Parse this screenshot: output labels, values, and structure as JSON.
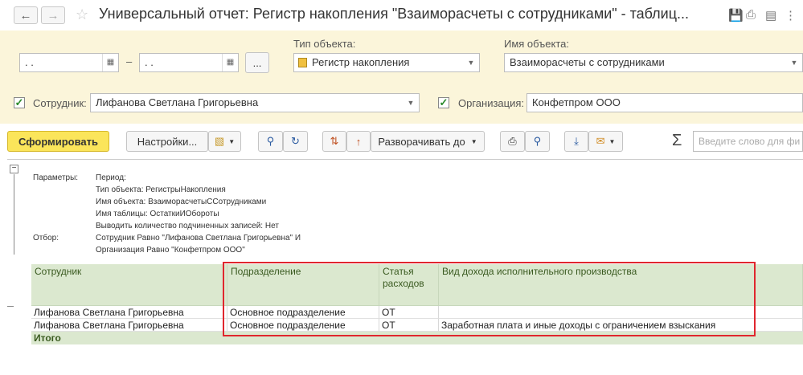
{
  "window": {
    "title": "Универсальный отчет: Регистр накопления \"Взаиморасчеты с сотрудниками\" - таблиц..."
  },
  "form": {
    "date_from": " .  . ",
    "date_sep": "–",
    "date_to": " .  . ",
    "more_btn": "...",
    "object_type_label": "Тип объекта:",
    "object_type_value": "Регистр накопления",
    "object_name_label": "Имя объекта:",
    "object_name_value": "Взаиморасчеты с сотрудниками",
    "employee_label": "Сотрудник:",
    "employee_value": "Лифанова Светлана Григорьевна",
    "org_label": "Организация:",
    "org_value": "Конфетпром ООО"
  },
  "toolbar": {
    "generate": "Сформировать",
    "settings": "Настройки...",
    "expand": "Разворачивать до",
    "search_placeholder": "Введите слово для фи"
  },
  "report": {
    "params_label": "Параметры:",
    "params": [
      "Период:",
      "Тип объекта: РегистрыНакопления",
      "Имя объекта: ВзаиморасчетыССотрудниками",
      "Имя таблицы: ОстаткиИОбороты",
      "Выводить количество подчиненных записей: Нет"
    ],
    "filter_label": "Отбор:",
    "filters": [
      "Сотрудник Равно \"Лифанова Светлана Григорьевна\" И",
      "Организация Равно \"Конфетпром ООО\""
    ],
    "columns": {
      "employee": "Сотрудник",
      "division": "Подразделение",
      "expense": "Статья расходов",
      "income_type": "Вид дохода исполнительного производства"
    },
    "rows": [
      {
        "employee": "Лифанова Светлана Григорьевна",
        "division": "Основное подразделение",
        "expense": "ОТ",
        "income_type": ""
      },
      {
        "employee": "Лифанова Светлана Григорьевна",
        "division": "Основное подразделение",
        "expense": "ОТ",
        "income_type": "Заработная плата и иные доходы с ограничением взыскания"
      }
    ],
    "total": "Итого"
  }
}
